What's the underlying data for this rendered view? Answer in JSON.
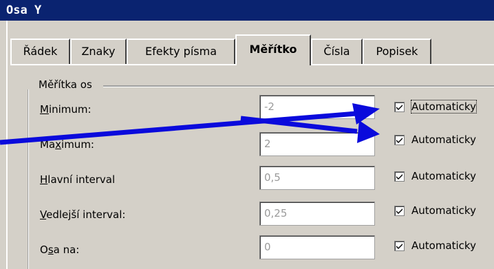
{
  "window": {
    "title": "Osa Y"
  },
  "tabs": [
    {
      "label": "Řádek",
      "active": false
    },
    {
      "label": "Znaky",
      "active": false
    },
    {
      "label": "Efekty písma",
      "active": false
    },
    {
      "label": "Měřítko",
      "active": true
    },
    {
      "label": "Čísla",
      "active": false
    },
    {
      "label": "Popisek",
      "active": false
    }
  ],
  "scale_group": {
    "label": "Měřítka os",
    "rows": [
      {
        "label_pre": "",
        "label_key": "M",
        "label_post": "inimum:",
        "value": "-2",
        "auto_checked": true,
        "auto_label": "Automaticky"
      },
      {
        "label_pre": "Ma",
        "label_key": "x",
        "label_post": "imum:",
        "value": "2",
        "auto_checked": true,
        "auto_label": "Automaticky"
      },
      {
        "label_pre": "",
        "label_key": "H",
        "label_post": "lavní interval",
        "value": "0,5",
        "auto_checked": true,
        "auto_label": "Automaticky"
      },
      {
        "label_pre": "",
        "label_key": "V",
        "label_post": "edlejší interval:",
        "value": "0,25",
        "auto_checked": true,
        "auto_label": "Automaticky"
      },
      {
        "label_pre": "O",
        "label_key": "s",
        "label_post": "a na:",
        "value": "0",
        "auto_checked": true,
        "auto_label": "Automaticky"
      }
    ]
  },
  "annotation": {
    "arrow_color": "#0a0adc"
  }
}
